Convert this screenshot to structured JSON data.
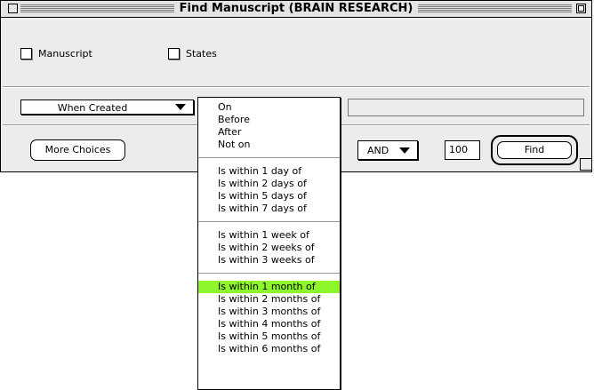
{
  "window": {
    "title": "Find Manuscript (BRAIN RESEARCH)"
  },
  "checkboxes": [
    {
      "label": "Manuscript",
      "checked": false
    },
    {
      "label": "States",
      "checked": false
    }
  ],
  "field_popup": {
    "value": "When Created"
  },
  "criteria_menu": {
    "groups": [
      [
        "On",
        "Before",
        "After",
        "Not on"
      ],
      [
        "Is within 1 day of",
        "Is within 2 days of",
        "Is within 5 days of",
        "Is within 7 days of"
      ],
      [
        "Is within 1 week of",
        "Is within 2 weeks of",
        "Is within 3 weeks of"
      ],
      [
        "Is within 1 month of",
        "Is within 2 months of",
        "Is within 3 months of",
        "Is within 4 months of",
        "Is within 5 months of",
        "Is within 6 months of"
      ]
    ],
    "selected": "Is within 1 month of",
    "highlight_color": "#8df52a"
  },
  "value_field": {
    "value": ""
  },
  "buttons": {
    "more_choices": "More Choices",
    "find": "Find"
  },
  "conjunction_popup": {
    "value": "AND"
  },
  "max_results": "100"
}
